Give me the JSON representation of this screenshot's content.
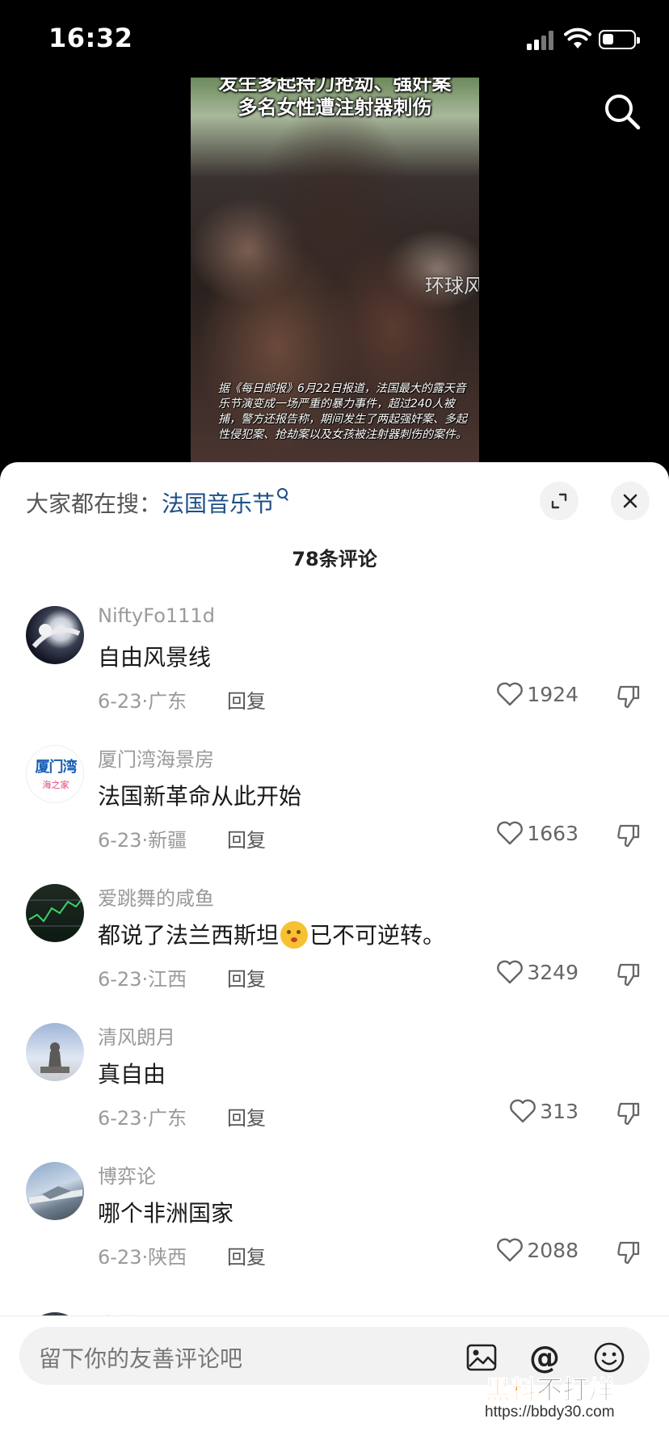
{
  "status_bar": {
    "time": "16:32"
  },
  "video": {
    "title_line1": "发生多起持刀抢劫、强奸案",
    "title_line2": "多名女性遭注射器刺伤",
    "watermark": "环球风",
    "caption": "据《每日邮报》6月22日报道，法国最大的露天音乐节演变成一场严重的暴力事件，超过240人被捕，警方还报告称，期间发生了两起强奸案、多起性侵犯案、抢劫案以及女孩被注射器刺伤的案件。"
  },
  "sheet": {
    "hot_search_label": "大家都在搜：",
    "hot_search_term": "法国音乐节",
    "comment_count": "78条评论"
  },
  "comments": [
    {
      "username": "NiftyFo111d",
      "text": "自由风景线",
      "date": "6-23",
      "location": "广东",
      "reply_label": "回复",
      "likes": "1924"
    },
    {
      "username": "厦门湾海景房",
      "text": "法国新革命从此开始",
      "date": "6-23",
      "location": "新疆",
      "reply_label": "回复",
      "likes": "1663"
    },
    {
      "username": "爱跳舞的咸鱼",
      "text_before": "都说了法兰西斯坦",
      "text_after": "已不可逆转。",
      "date": "6-23",
      "location": "江西",
      "reply_label": "回复",
      "likes": "3249"
    },
    {
      "username": "清风朗月",
      "text": "真自由",
      "date": "6-23",
      "location": "广东",
      "reply_label": "回复",
      "likes": "313"
    },
    {
      "username": "博弈论",
      "text": "哪个非洲国家",
      "date": "6-23",
      "location": "陕西",
      "reply_label": "回复",
      "likes": "2088"
    },
    {
      "username": "寒蝉"
    }
  ],
  "avatars": {
    "avatar2_text_top": "厦门湾",
    "avatar2_text_bottom": "海之家"
  },
  "bottom_bar": {
    "placeholder": "留下你的友善评论吧",
    "mention_symbol": "@"
  },
  "site_watermark": {
    "logo_a": "黑料",
    "logo_b": "不打烊",
    "url": "https://bbdy30.com"
  },
  "colors": {
    "link_blue": "#1d4f86",
    "sheet_bg": "#ffffff",
    "muted_text": "#9a9a9a"
  }
}
